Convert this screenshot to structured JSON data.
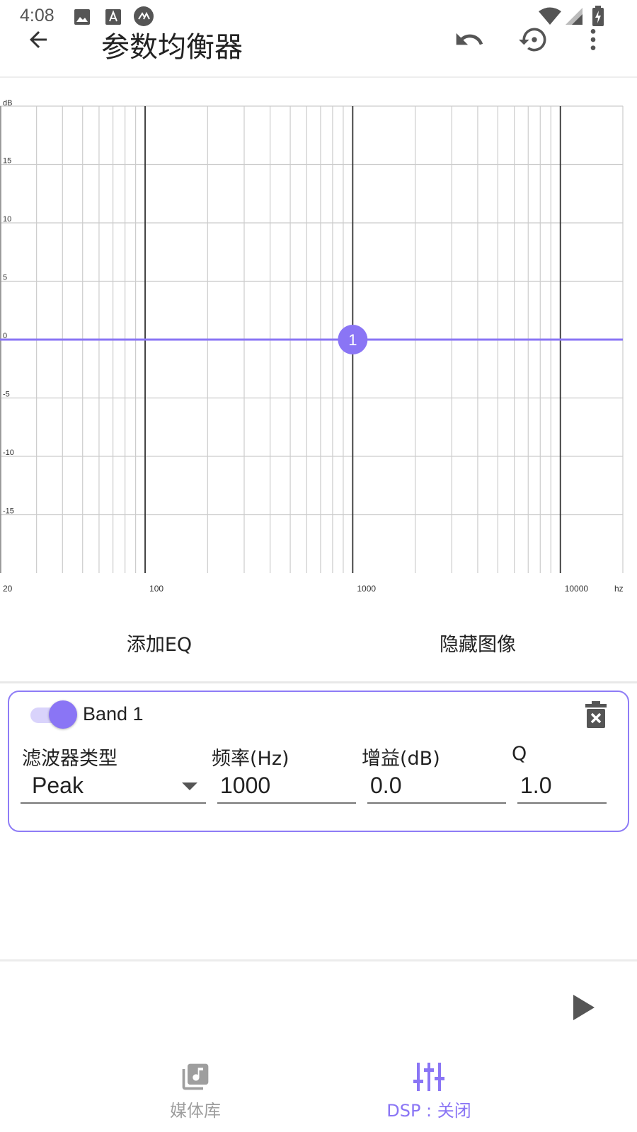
{
  "status_bar": {
    "time": "4:08"
  },
  "app_bar": {
    "title": "参数均衡器"
  },
  "chart_data": {
    "type": "line",
    "y_unit_label": "dB",
    "x_unit_label": "hz",
    "x_scale": "log",
    "xlim": [
      20,
      20000
    ],
    "ylim": [
      -20,
      20
    ],
    "y_ticks": [
      "15",
      "10",
      "5",
      "0",
      "-5",
      "-10",
      "-15"
    ],
    "x_ticks": [
      "20",
      "100",
      "1000",
      "10000"
    ],
    "grid": true,
    "series": [
      {
        "x": [
          20,
          1000,
          20000
        ],
        "y": [
          0,
          0,
          0
        ]
      }
    ],
    "band_markers": [
      {
        "label": "1",
        "freq": 1000,
        "gain": 0
      }
    ],
    "colors": {
      "curve": "#8a75f5",
      "grid": "#cccccc",
      "decade": "#333333"
    }
  },
  "actions": {
    "add_eq": "添加EQ",
    "hide_graph": "隐藏图像"
  },
  "band": {
    "name": "Band 1",
    "enabled": true,
    "labels": {
      "filter_type": "滤波器类型",
      "frequency": "频率(Hz)",
      "gain": "增益(dB)",
      "q": "Q"
    },
    "values": {
      "filter_type": "Peak",
      "frequency": "1000",
      "gain": "0.0",
      "q": "1.0"
    }
  },
  "bottom_nav": {
    "library": "媒体库",
    "dsp": "DSP : 关闭"
  },
  "colors": {
    "accent": "#8a75f5",
    "inactive": "#9e9e9e"
  }
}
